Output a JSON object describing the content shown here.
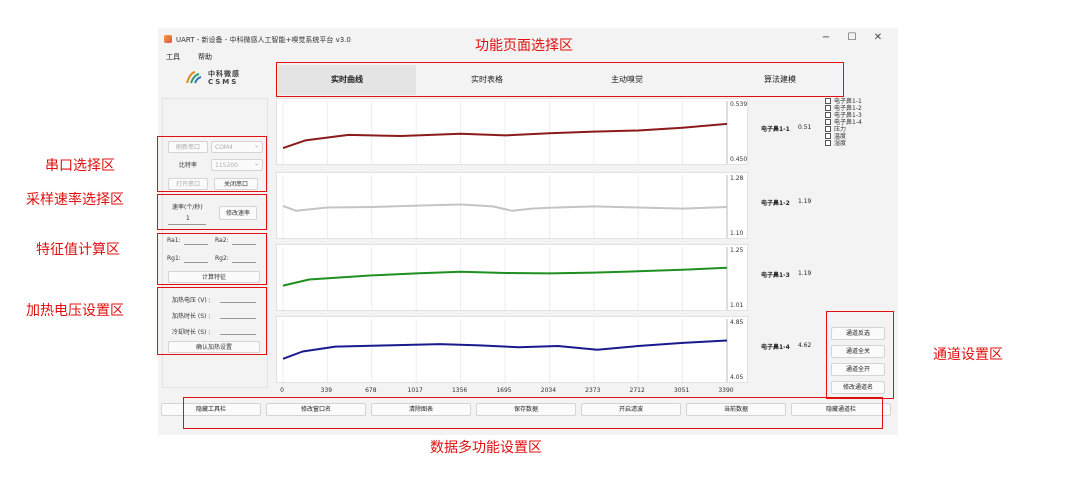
{
  "window": {
    "title": "UART - 新设备 - 中科微感人工智能+嗅觉系统平台 v3.0",
    "minimize": "−",
    "maximize": "☐",
    "close": "✕"
  },
  "menu": {
    "tools": "工具",
    "help": "帮助"
  },
  "logo": {
    "line1": "中科微感",
    "line2": "CSMS"
  },
  "tabs": [
    "实时曲线",
    "实时表格",
    "主动嗅觉",
    "算法建模"
  ],
  "serial": {
    "refresh_label": "刷新串口",
    "port": "COM4",
    "baud_label": "比特率",
    "baud": "115200",
    "open_label": "打开串口",
    "close_label": "关闭串口"
  },
  "rate": {
    "label": "速率(个/秒)",
    "value": "1",
    "button": "修改速率"
  },
  "features": {
    "ra1": "Ra1:",
    "ra2": "Ra2:",
    "rg1": "Rg1:",
    "rg2": "Rg2:",
    "button": "计算特征"
  },
  "heating": {
    "voltage": "加热电压 (V) :",
    "time": "加热时长 (S) :",
    "cool": "冷却时长 (S) :",
    "button": "确认加热设置"
  },
  "channels": {
    "list": [
      "电子鼻1-1",
      "电子鼻1-2",
      "电子鼻1-3",
      "电子鼻1-4",
      "压力",
      "温度",
      "湿度"
    ],
    "buttons": [
      "通道反选",
      "通道全关",
      "通道全开",
      "修改通道名"
    ]
  },
  "bottom_buttons": [
    "隐藏工具栏",
    "修改窗口名",
    "清除图表",
    "保存数据",
    "开启滤波",
    "当前数据",
    "隐藏通道栏"
  ],
  "annotations": {
    "page_select": "功能页面选择区",
    "serial": "串口选择区",
    "rate": "采样速率选择区",
    "feature": "特征值计算区",
    "heating": "加热电压设置区",
    "channel": "通道设置区",
    "data": "数据多功能设置区"
  },
  "colors": {
    "ch1": "#8b1a1a",
    "ch2": "#c4c4c4",
    "ch3": "#1f8f1f",
    "ch4": "#1a1a8f",
    "annotation": "#e01010"
  },
  "chart_data": {
    "type": "line",
    "x_ticks": [
      "0",
      "339",
      "678",
      "1017",
      "1356",
      "1695",
      "2034",
      "2373",
      "2712",
      "3051",
      "3390"
    ],
    "xlim": [
      0,
      3390
    ],
    "series": [
      {
        "name": "电子鼻1-1",
        "value_label": "0.51",
        "ymax_label": "0.539",
        "ymin_label": "0.450",
        "ylim": [
          0.45,
          0.539
        ],
        "x": [
          0,
          170,
          500,
          900,
          1356,
          1700,
          2034,
          2373,
          2712,
          3051,
          3390
        ],
        "y": [
          0.468,
          0.482,
          0.492,
          0.49,
          0.494,
          0.491,
          0.495,
          0.498,
          0.5,
          0.505,
          0.512
        ]
      },
      {
        "name": "电子鼻1-2",
        "value_label": "1.19",
        "ymax_label": "1.28",
        "ymin_label": "1.10",
        "ylim": [
          1.1,
          1.28
        ],
        "x": [
          0,
          100,
          339,
          678,
          1017,
          1356,
          1600,
          1750,
          1900,
          2034,
          2373,
          2712,
          3051,
          3390
        ],
        "y": [
          1.196,
          1.178,
          1.19,
          1.192,
          1.197,
          1.201,
          1.194,
          1.178,
          1.186,
          1.189,
          1.194,
          1.19,
          1.186,
          1.192
        ]
      },
      {
        "name": "电子鼻1-3",
        "value_label": "1.19",
        "ymax_label": "1.25",
        "ymin_label": "1.01",
        "ylim": [
          1.01,
          1.25
        ],
        "x": [
          0,
          200,
          678,
          1017,
          1356,
          1695,
          2034,
          2373,
          2712,
          3051,
          3390
        ],
        "y": [
          1.1,
          1.13,
          1.15,
          1.16,
          1.168,
          1.162,
          1.16,
          1.164,
          1.17,
          1.178,
          1.188
        ]
      },
      {
        "name": "电子鼻1-4",
        "value_label": "4.62",
        "ymax_label": "4.85",
        "ymin_label": "4.05",
        "ylim": [
          4.05,
          4.85
        ],
        "x": [
          0,
          150,
          400,
          800,
          1200,
          1500,
          1800,
          2100,
          2400,
          2712,
          3051,
          3390
        ],
        "y": [
          4.33,
          4.45,
          4.53,
          4.55,
          4.57,
          4.55,
          4.52,
          4.54,
          4.48,
          4.54,
          4.59,
          4.63
        ]
      }
    ]
  }
}
